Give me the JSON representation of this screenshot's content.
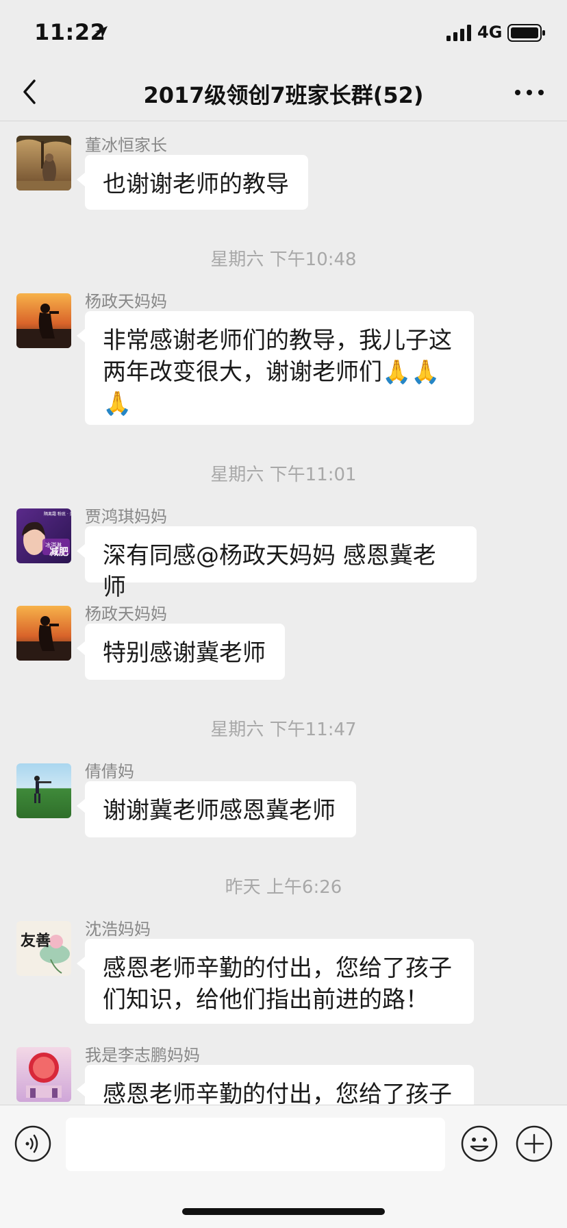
{
  "status_bar": {
    "time": "11:22",
    "network": "4G"
  },
  "header": {
    "title": "2017级领创7班家长群(52)"
  },
  "messages": [
    {
      "sender": "董冰恒家长",
      "text": "也谢谢老师的教导"
    },
    {
      "timestamp": "星期六 下午10:48"
    },
    {
      "sender": "杨政天妈妈",
      "text": "非常感谢老师们的教导，我儿子这两年改变很大，谢谢老师们🙏🙏🙏"
    },
    {
      "timestamp": "星期六 下午11:01"
    },
    {
      "sender": "贾鸿琪妈妈",
      "text": "深有同感@杨政天妈妈 感恩冀老师"
    },
    {
      "sender": "杨政天妈妈",
      "text": "特别感谢冀老师"
    },
    {
      "timestamp": "星期六 下午11:47"
    },
    {
      "sender": "倩倩妈",
      "text": "谢谢冀老师感恩冀老师"
    },
    {
      "timestamp": "昨天 上午6:26"
    },
    {
      "sender": "沈浩妈妈",
      "text": "感恩老师辛勤的付出，您给了孩子们知识，给他们指出前进的路！"
    },
    {
      "sender": "我是李志鹏妈妈",
      "text": "感恩老师辛勤的付出，您给了孩子"
    }
  ],
  "avatars": {
    "avatar_3": {
      "text": "减肥",
      "top_text": "隔离霜 粉底 · 美白",
      "mid_text": "冰淇淋"
    },
    "avatar_6": {
      "text": "友善"
    }
  },
  "input": {
    "placeholder": ""
  }
}
